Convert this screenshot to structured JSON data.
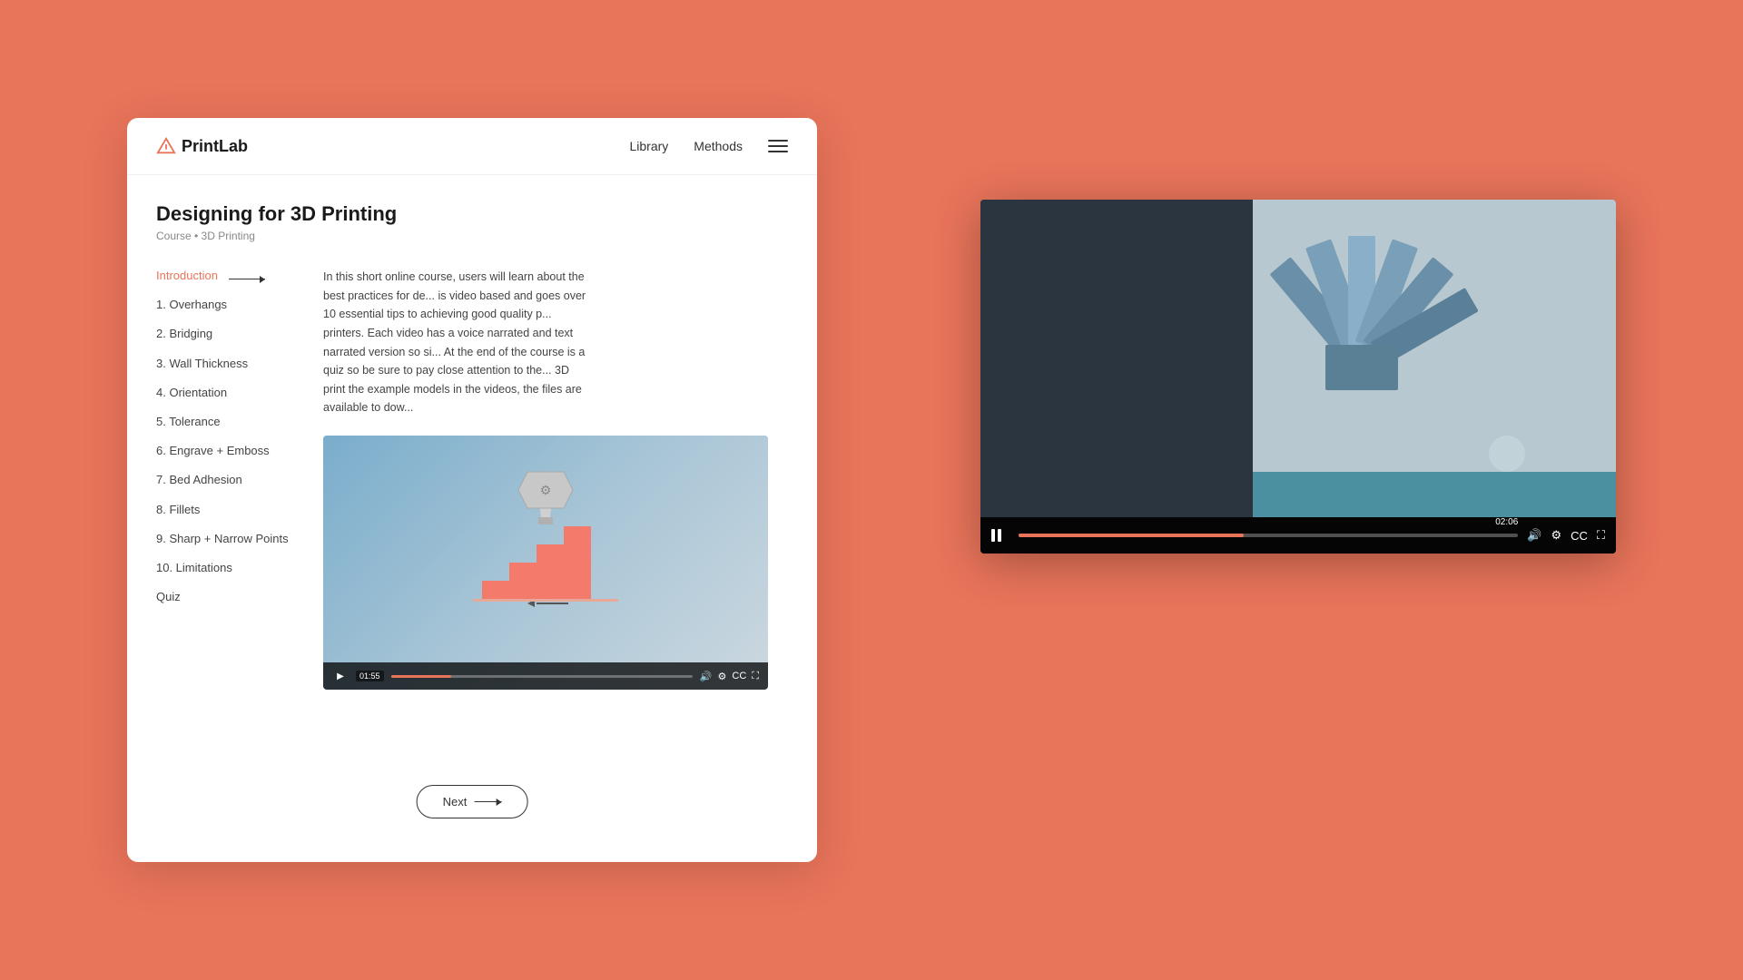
{
  "nav": {
    "logo": "PrintLab",
    "links": [
      "Library",
      "Methods"
    ],
    "hamburger_label": "Menu"
  },
  "page": {
    "title": "Designing for 3D Printing",
    "meta": "Course • 3D Printing"
  },
  "sidebar": {
    "items": [
      {
        "label": "Introduction",
        "active": true,
        "id": "introduction"
      },
      {
        "label": "1. Overhangs",
        "id": "overhangs"
      },
      {
        "label": "2. Bridging",
        "id": "bridging"
      },
      {
        "label": "3. Wall Thickness",
        "id": "wall-thickness"
      },
      {
        "label": "4. Orientation",
        "id": "orientation"
      },
      {
        "label": "5. Tolerance",
        "id": "tolerance"
      },
      {
        "label": "6. Engrave + Emboss",
        "id": "engrave-emboss"
      },
      {
        "label": "7. Bed Adhesion",
        "id": "bed-adhesion"
      },
      {
        "label": "8. Fillets",
        "id": "fillets"
      },
      {
        "label": "9. Sharp + Narrow Points",
        "id": "sharp-narrow-points"
      },
      {
        "label": "10. Limitations",
        "id": "limitations"
      },
      {
        "label": "Quiz",
        "id": "quiz"
      }
    ]
  },
  "description": "In this short online course, users will learn about the best practices for de... is video based and goes over 10 essential tips to achieving good quality p... printers. Each video has a voice narrated and text narrated version so si... At the end of the course is a quiz so be sure to pay close attention to the... 3D print the example models in the videos, the files are available to dow...",
  "video_small": {
    "time": "01:55",
    "progress": 20
  },
  "video_large": {
    "time": "02:06",
    "progress": 45
  },
  "buttons": {
    "next": "Next"
  }
}
